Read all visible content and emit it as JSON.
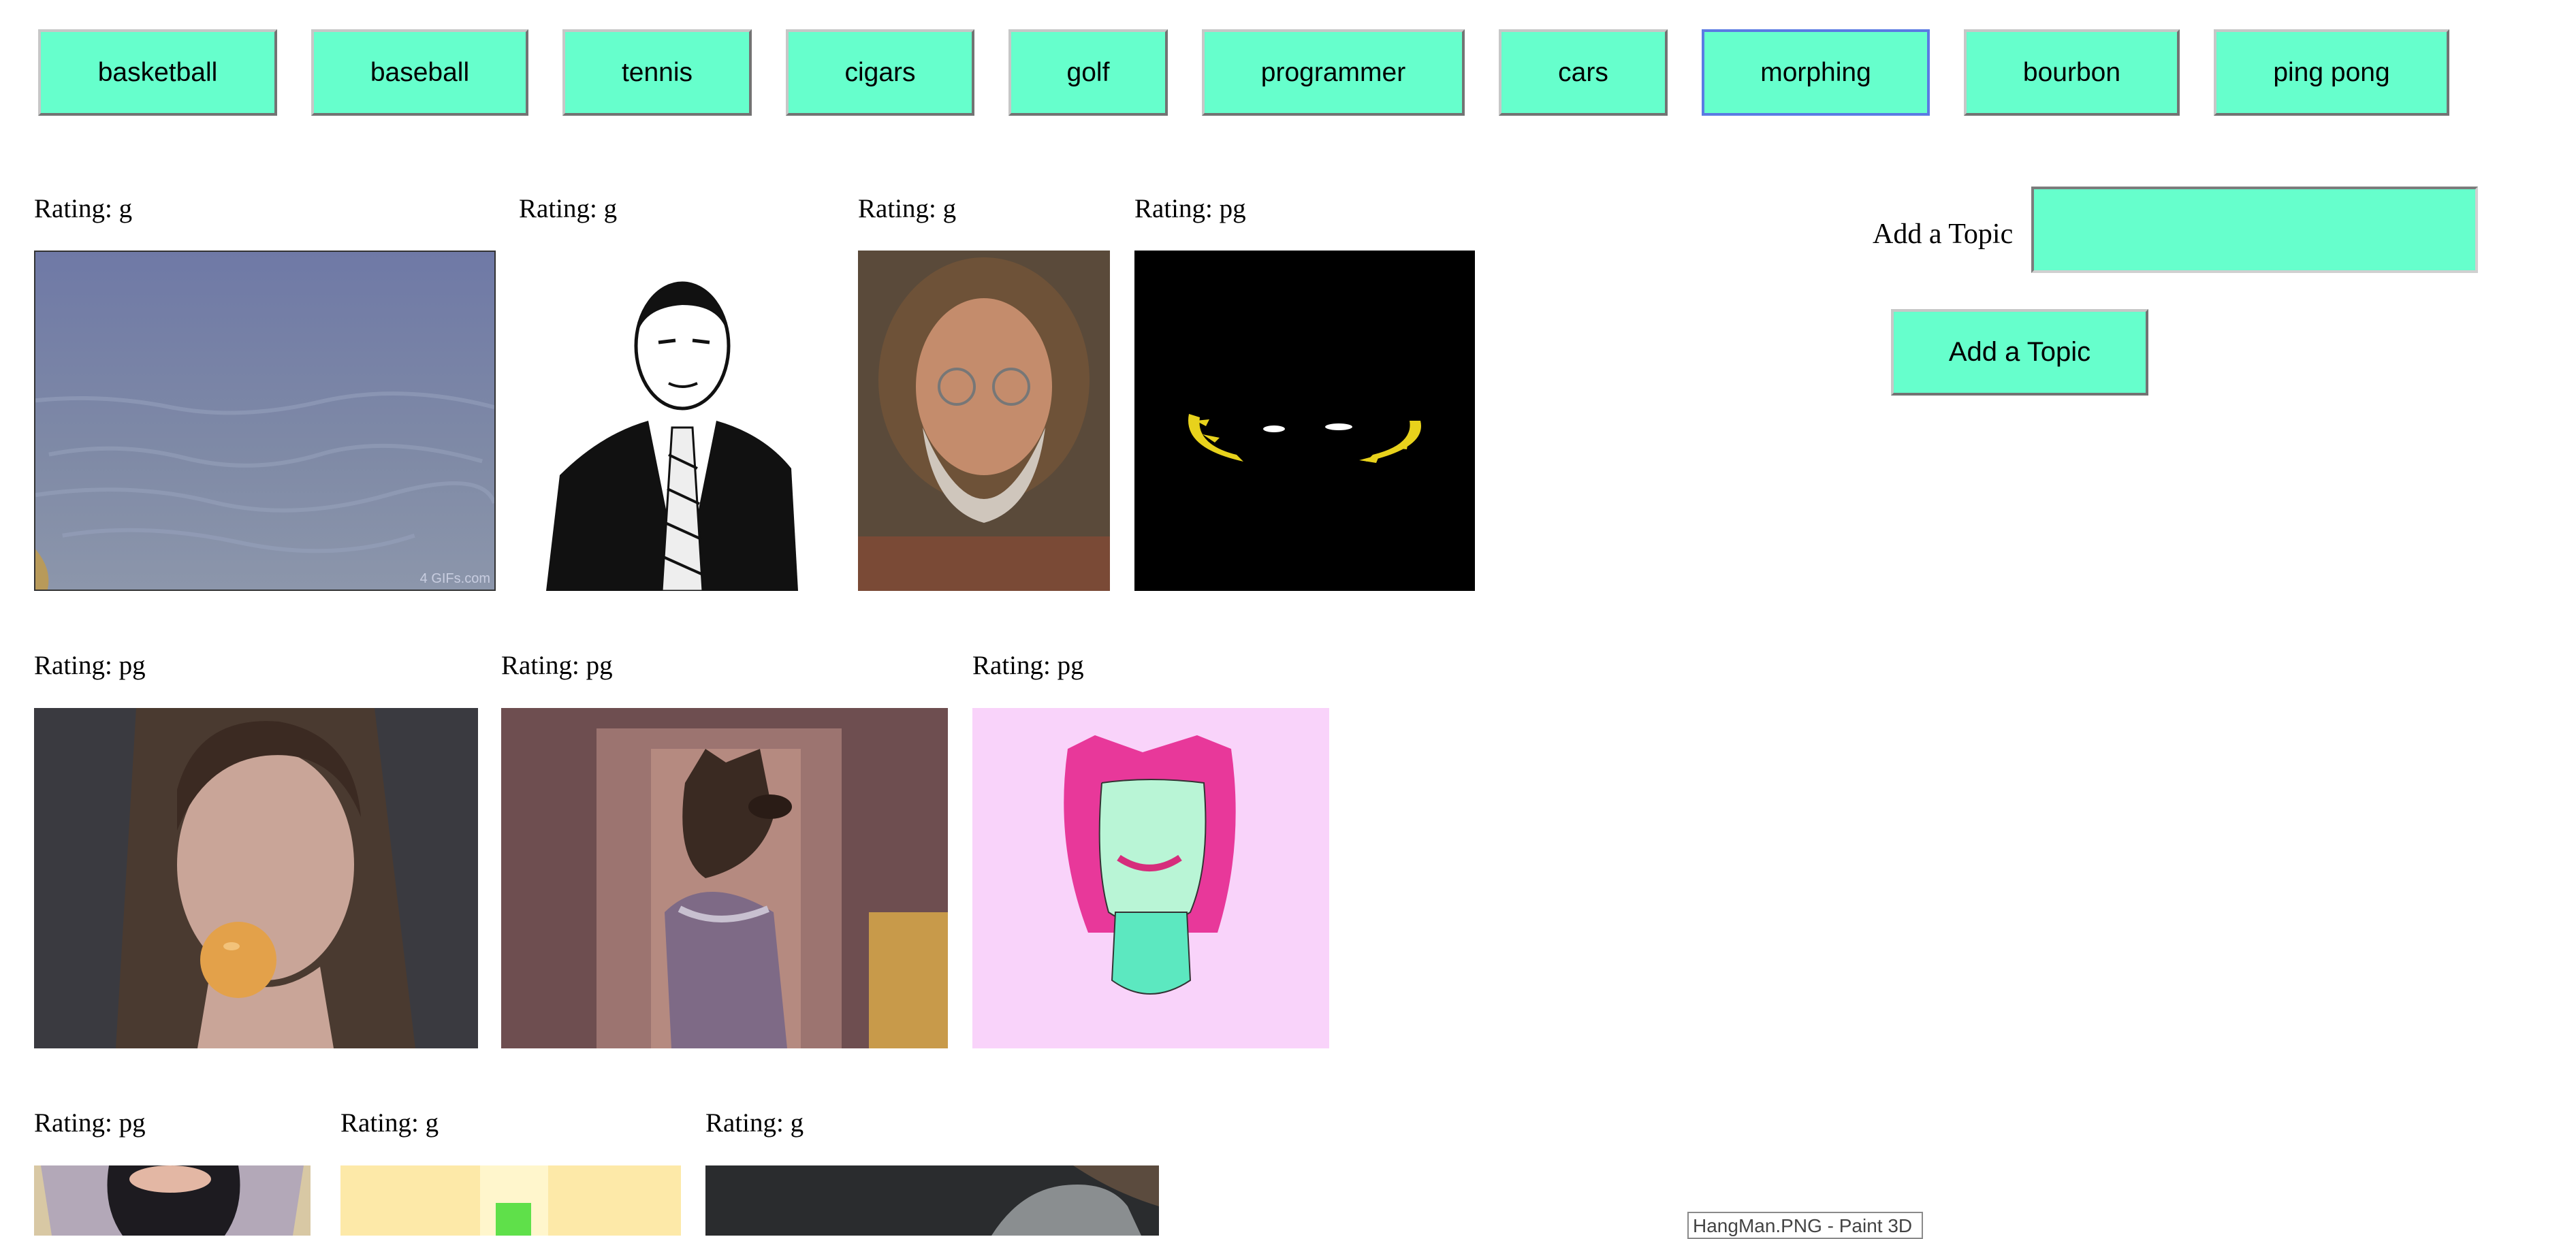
{
  "topics": [
    "basketball",
    "baseball",
    "tennis",
    "cigars",
    "golf",
    "programmer",
    "cars",
    "morphing",
    "bourbon",
    "ping pong"
  ],
  "add_topic": {
    "label": "Add a Topic",
    "input_value": "",
    "button_label": "Add a Topic"
  },
  "gifs": [
    {
      "rating": "Rating: g",
      "description": "water surface"
    },
    {
      "rating": "Rating: g",
      "description": "man in suit drawing"
    },
    {
      "rating": "Rating: g",
      "description": "bearded man with glasses"
    },
    {
      "rating": "Rating: pg",
      "description": "yellow eyes on black"
    },
    {
      "rating": "Rating: pg",
      "description": "woman with orange in mouth"
    },
    {
      "rating": "Rating: pg",
      "description": "dog in sweater"
    },
    {
      "rating": "Rating: pg",
      "description": "pink-haired face drawing"
    },
    {
      "rating": "Rating: pg",
      "description": "framed portrait"
    },
    {
      "rating": "Rating: g",
      "description": "yellow and green graphic"
    },
    {
      "rating": "Rating: g",
      "description": "dark scene"
    }
  ],
  "gif_watermark": "4 GIFs.com",
  "taskbar_tooltip": "HangMan.PNG - Paint 3D"
}
